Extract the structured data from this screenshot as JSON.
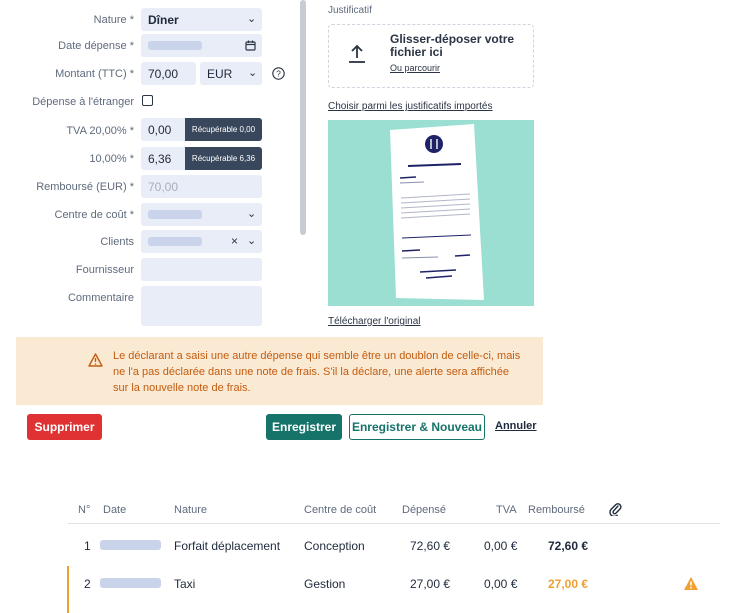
{
  "form": {
    "nature_label": "Nature *",
    "nature_value": "Dîner",
    "date_label": "Date dépense *",
    "amount_label": "Montant (TTC) *",
    "amount_value": "70,00",
    "currency_value": "EUR",
    "foreign_label": "Dépense à l'étranger",
    "tva1_label": "TVA 20,00% *",
    "tva1_value": "0,00",
    "tva1_recup": "Récupérable 0,00",
    "tva2_label": "10,00% *",
    "tva2_value": "6,36",
    "tva2_recup": "Récupérable 6,36",
    "refund_label": "Remboursé (EUR) *",
    "refund_placeholder": "70,00",
    "cost_center_label": "Centre de coût *",
    "clients_label": "Clients",
    "supplier_label": "Fournisseur",
    "comment_label": "Commentaire"
  },
  "receipt": {
    "section_label": "Justificatif",
    "drop_title": "Glisser-déposer votre fichier ici",
    "browse_link": "Ou parcourir",
    "choose_link": "Choisir parmi les justificatifs importés",
    "download_link": "Télécharger l'original",
    "bg_color": "#9adfd2"
  },
  "warning": {
    "text": "Le déclarant a saisi une autre dépense qui semble être un doublon de celle-ci, mais ne l'a pas déclarée dans une note de frais. S'il la déclare, une alerte sera affichée sur la nouvelle note de frais.",
    "color": "#c25c10",
    "bg_color": "#fbead3"
  },
  "actions": {
    "delete": "Supprimer",
    "save": "Enregistrer",
    "save_new": "Enregistrer & Nouveau",
    "cancel": "Annuler"
  },
  "table": {
    "headers": {
      "num": "N°",
      "date": "Date",
      "nature": "Nature",
      "cost_center": "Centre de coût",
      "spent": "Dépensé",
      "tva": "TVA",
      "refunded": "Remboursé"
    },
    "rows": [
      {
        "num": "1",
        "nature": "Forfait déplacement",
        "cost_center": "Conception",
        "spent": "72,60 €",
        "tva": "0,00 €",
        "refunded": "72,60 €"
      },
      {
        "num": "2",
        "nature": "Taxi",
        "cost_center": "Gestion",
        "spent": "27,00 €",
        "tva": "0,00 €",
        "refunded": "27,00 €"
      }
    ]
  },
  "colors": {
    "delete": "#e03232",
    "save": "#16736a",
    "field": "#e8edf7",
    "dark": "#39475c"
  }
}
